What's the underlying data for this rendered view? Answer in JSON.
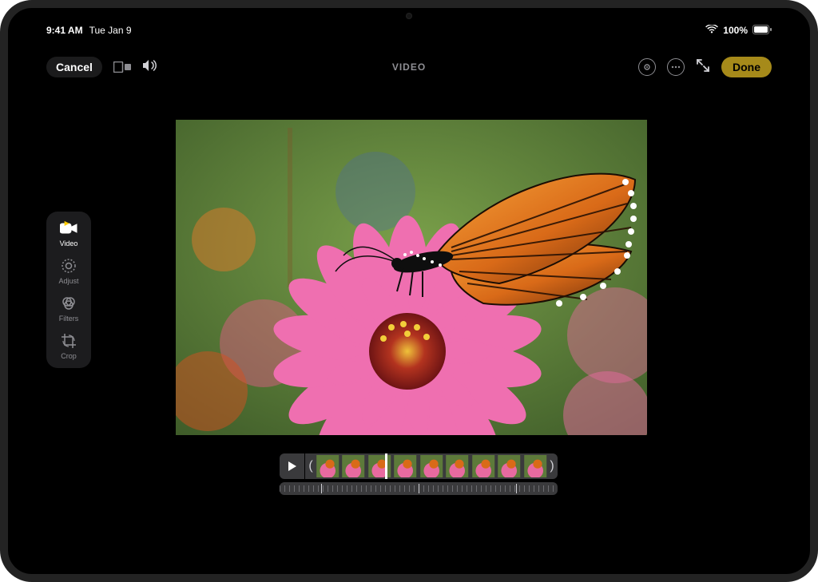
{
  "status": {
    "time": "9:41 AM",
    "date": "Tue Jan 9",
    "battery": "100%"
  },
  "toolbar": {
    "cancel": "Cancel",
    "title": "VIDEO",
    "done": "Done"
  },
  "sidebar": {
    "items": [
      {
        "label": "Video",
        "active": true
      },
      {
        "label": "Adjust",
        "active": false
      },
      {
        "label": "Filters",
        "active": false
      },
      {
        "label": "Crop",
        "active": false
      }
    ]
  },
  "timeline": {
    "playing": false,
    "frame_count": 9
  }
}
